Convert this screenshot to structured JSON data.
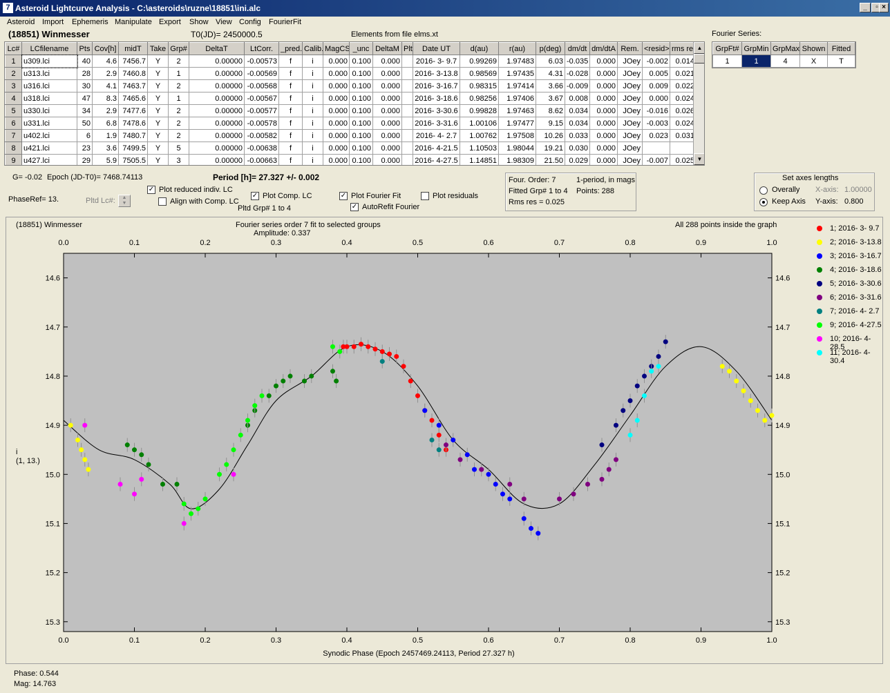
{
  "window": {
    "title": "Asteroid Lightcurve Analysis - C:\\asteroids\\ruzne\\18851\\ini.alc"
  },
  "menu": [
    "Asteroid",
    "Import",
    "Ephemeris",
    "Manipulate",
    "Export",
    "Show",
    "View",
    "Config",
    "FourierFit"
  ],
  "header": {
    "asteroid": "(18851) Winmesser",
    "t0": "T0(JD)= 2450000.5",
    "elements": "Elements from file elms.xt"
  },
  "lc_table": {
    "columns": [
      "Lc#",
      "LCfilename",
      "Pts",
      "Cov[h]",
      "midT",
      "Take",
      "Grp#",
      "DeltaT",
      "LtCorr.",
      "_pred.",
      "Calib.",
      "MagCS",
      "_unc",
      "DeltaM",
      "Plt",
      "Date UT",
      "d(au)",
      "r(au)",
      "p(deg)",
      "dm/dt",
      "dm/dtA",
      "Rem.",
      "<resid>",
      "rms res"
    ],
    "rows": [
      [
        "1",
        "u309.lci",
        "40",
        "4.6",
        "7456.7",
        "Y",
        "2",
        "0.00000",
        "-0.00573",
        "f",
        "i",
        "0.000",
        "0.100",
        "0.000",
        "",
        "2016- 3- 9.7",
        "0.99269",
        "1.97483",
        "6.03",
        "-0.035",
        "0.000",
        "JOey",
        "-0.002",
        "0.014"
      ],
      [
        "2",
        "u313.lci",
        "28",
        "2.9",
        "7460.8",
        "Y",
        "1",
        "0.00000",
        "-0.00569",
        "f",
        "i",
        "0.000",
        "0.100",
        "0.000",
        "",
        "2016- 3-13.8",
        "0.98569",
        "1.97435",
        "4.31",
        "-0.028",
        "0.000",
        "JOey",
        "0.005",
        "0.021"
      ],
      [
        "3",
        "u316.lci",
        "30",
        "4.1",
        "7463.7",
        "Y",
        "2",
        "0.00000",
        "-0.00568",
        "f",
        "i",
        "0.000",
        "0.100",
        "0.000",
        "",
        "2016- 3-16.7",
        "0.98315",
        "1.97414",
        "3.66",
        "-0.009",
        "0.000",
        "JOey",
        "0.009",
        "0.022"
      ],
      [
        "4",
        "u318.lci",
        "47",
        "8.3",
        "7465.6",
        "Y",
        "1",
        "0.00000",
        "-0.00567",
        "f",
        "i",
        "0.000",
        "0.100",
        "0.000",
        "",
        "2016- 3-18.6",
        "0.98256",
        "1.97406",
        "3.67",
        "0.008",
        "0.000",
        "JOey",
        "0.000",
        "0.024"
      ],
      [
        "5",
        "u330.lci",
        "34",
        "2.9",
        "7477.6",
        "Y",
        "2",
        "0.00000",
        "-0.00577",
        "f",
        "i",
        "0.000",
        "0.100",
        "0.000",
        "",
        "2016- 3-30.6",
        "0.99828",
        "1.97463",
        "8.62",
        "0.034",
        "0.000",
        "JOey",
        "-0.016",
        "0.026"
      ],
      [
        "6",
        "u331.lci",
        "50",
        "6.8",
        "7478.6",
        "Y",
        "2",
        "0.00000",
        "-0.00578",
        "f",
        "i",
        "0.000",
        "0.100",
        "0.000",
        "",
        "2016- 3-31.6",
        "1.00106",
        "1.97477",
        "9.15",
        "0.034",
        "0.000",
        "JOey",
        "-0.003",
        "0.024"
      ],
      [
        "7",
        "u402.lci",
        "6",
        "1.9",
        "7480.7",
        "Y",
        "2",
        "0.00000",
        "-0.00582",
        "f",
        "i",
        "0.000",
        "0.100",
        "0.000",
        "",
        "2016- 4- 2.7",
        "1.00762",
        "1.97508",
        "10.26",
        "0.033",
        "0.000",
        "JOey",
        "0.023",
        "0.031"
      ],
      [
        "8",
        "u421.lci",
        "23",
        "3.6",
        "7499.5",
        "Y",
        "5",
        "0.00000",
        "-0.00638",
        "f",
        "i",
        "0.000",
        "0.100",
        "0.000",
        "",
        "2016- 4-21.5",
        "1.10503",
        "1.98044",
        "19.21",
        "0.030",
        "0.000",
        "JOey",
        "",
        ""
      ],
      [
        "9",
        "u427.lci",
        "29",
        "5.9",
        "7505.5",
        "Y",
        "3",
        "0.00000",
        "-0.00663",
        "f",
        "i",
        "0.000",
        "0.100",
        "0.000",
        "",
        "2016- 4-27.5",
        "1.14851",
        "1.98309",
        "21.50",
        "0.029",
        "0.000",
        "JOey",
        "-0.007",
        "0.025"
      ]
    ]
  },
  "fourier_table": {
    "label": "Fourier Series:",
    "columns": [
      "GrpFt#",
      "GrpMin",
      "GrpMax",
      "Shown",
      "Fitted"
    ],
    "row": [
      "1",
      "1",
      "4",
      "X",
      "T"
    ]
  },
  "info": {
    "g": "G= -0.02",
    "epoch": "Epoch (JD-T0)= 7468.74113",
    "period": "Period [h]= 27.327 +/- 0.002",
    "phaseref": "PhaseRef= 13.",
    "pltd_lc": "Pltd Lc#:",
    "plot_reduced": "Plot reduced indiv. LC",
    "align_comp": "Align with Comp. LC",
    "plot_comp": "Plot Comp. LC",
    "pltd_grp": "Pltd Grp#  1   to   4",
    "plot_fourier": "Plot Fourier Fit",
    "autorefit": "AutoRefit Fourier",
    "plot_residuals": "Plot residuals",
    "four_order": "Four. Order:  7",
    "one_period": "1-period, in mags",
    "fitted_grp": "Fitted Grp# 1 to 4",
    "points": "Points: 288",
    "rms": "Rms res     = 0.025"
  },
  "axes_box": {
    "title": "Set axes lengths",
    "overally": "Overally",
    "keep_axis": "Keep Axis",
    "xaxis_label": "X-axis:",
    "xaxis_val": "1.00000",
    "yaxis_label": "Y-axis:",
    "yaxis_val": "0.800"
  },
  "plot": {
    "name": "(18851) Winmesser",
    "fit_title": "Fourier series order 7 fit to selected groups",
    "amplitude": "Amplitude: 0.337",
    "inside": "All 288 points inside the graph",
    "ylabel": "i",
    "ylabel2": "(1, 13.)",
    "xlabel": "Synodic Phase (Epoch 2457469.24113, Period 27.327 h)"
  },
  "status": {
    "phase": "Phase:  0.544",
    "mag": "Mag:    14.763"
  },
  "chart_data": {
    "type": "scatter",
    "xlim": [
      0,
      1
    ],
    "ylim": [
      14.55,
      15.32
    ],
    "y_inverted": true,
    "xticks": [
      0.0,
      0.1,
      0.2,
      0.3,
      0.4,
      0.5,
      0.6,
      0.7,
      0.8,
      0.9,
      1.0
    ],
    "yticks": [
      14.6,
      14.7,
      14.8,
      14.9,
      15.0,
      15.1,
      15.2,
      15.3
    ],
    "legend_position": "right",
    "series": [
      {
        "name": "1; 2016- 3- 9.7",
        "color": "#ff0000",
        "points": [
          [
            0.41,
            14.74
          ],
          [
            0.42,
            14.735
          ],
          [
            0.43,
            14.74
          ],
          [
            0.44,
            14.745
          ],
          [
            0.45,
            14.75
          ],
          [
            0.46,
            14.755
          ],
          [
            0.47,
            14.76
          ],
          [
            0.48,
            14.78
          ],
          [
            0.49,
            14.81
          ],
          [
            0.5,
            14.84
          ],
          [
            0.51,
            14.87
          ],
          [
            0.52,
            14.89
          ],
          [
            0.53,
            14.92
          ],
          [
            0.54,
            14.95
          ],
          [
            0.4,
            14.74
          ],
          [
            0.395,
            14.74
          ]
        ]
      },
      {
        "name": "2; 2016- 3-13.8",
        "color": "#ffff00",
        "points": [
          [
            0.01,
            14.9
          ],
          [
            0.02,
            14.93
          ],
          [
            0.025,
            14.95
          ],
          [
            0.03,
            14.97
          ],
          [
            0.035,
            14.99
          ],
          [
            0.93,
            14.78
          ],
          [
            0.94,
            14.79
          ],
          [
            0.95,
            14.81
          ],
          [
            0.96,
            14.83
          ],
          [
            0.97,
            14.85
          ],
          [
            0.98,
            14.87
          ],
          [
            0.99,
            14.89
          ],
          [
            1.0,
            14.88
          ]
        ]
      },
      {
        "name": "3; 2016- 3-16.7",
        "color": "#0000ff",
        "points": [
          [
            0.51,
            14.87
          ],
          [
            0.53,
            14.9
          ],
          [
            0.55,
            14.93
          ],
          [
            0.57,
            14.96
          ],
          [
            0.58,
            14.99
          ],
          [
            0.6,
            15.0
          ],
          [
            0.61,
            15.02
          ],
          [
            0.62,
            15.04
          ],
          [
            0.63,
            15.05
          ],
          [
            0.65,
            15.09
          ],
          [
            0.66,
            15.11
          ],
          [
            0.67,
            15.12
          ]
        ]
      },
      {
        "name": "4; 2016- 3-18.6",
        "color": "#008000",
        "points": [
          [
            0.09,
            14.94
          ],
          [
            0.1,
            14.95
          ],
          [
            0.11,
            14.96
          ],
          [
            0.12,
            14.98
          ],
          [
            0.14,
            15.02
          ],
          [
            0.16,
            15.02
          ],
          [
            0.26,
            14.9
          ],
          [
            0.27,
            14.87
          ],
          [
            0.29,
            14.84
          ],
          [
            0.3,
            14.82
          ],
          [
            0.31,
            14.81
          ],
          [
            0.32,
            14.8
          ],
          [
            0.34,
            14.81
          ],
          [
            0.35,
            14.8
          ],
          [
            0.38,
            14.79
          ],
          [
            0.385,
            14.81
          ]
        ]
      },
      {
        "name": "5; 2016- 3-30.6",
        "color": "#000080",
        "points": [
          [
            0.76,
            14.94
          ],
          [
            0.78,
            14.9
          ],
          [
            0.79,
            14.87
          ],
          [
            0.8,
            14.85
          ],
          [
            0.81,
            14.82
          ],
          [
            0.82,
            14.8
          ],
          [
            0.83,
            14.78
          ],
          [
            0.84,
            14.76
          ],
          [
            0.85,
            14.73
          ]
        ]
      },
      {
        "name": "6; 2016- 3-31.6",
        "color": "#800080",
        "points": [
          [
            0.54,
            14.94
          ],
          [
            0.56,
            14.97
          ],
          [
            0.59,
            14.99
          ],
          [
            0.63,
            15.02
          ],
          [
            0.65,
            15.05
          ],
          [
            0.7,
            15.05
          ],
          [
            0.72,
            15.04
          ],
          [
            0.74,
            15.02
          ],
          [
            0.76,
            15.01
          ],
          [
            0.77,
            14.99
          ],
          [
            0.78,
            14.97
          ]
        ]
      },
      {
        "name": "7; 2016- 4- 2.7",
        "color": "#008080",
        "points": [
          [
            0.45,
            14.77
          ],
          [
            0.52,
            14.93
          ],
          [
            0.53,
            14.95
          ]
        ]
      },
      {
        "name": "9; 2016- 4-27.5",
        "color": "#00ff00",
        "points": [
          [
            0.17,
            15.06
          ],
          [
            0.18,
            15.08
          ],
          [
            0.19,
            15.07
          ],
          [
            0.2,
            15.05
          ],
          [
            0.22,
            15.0
          ],
          [
            0.23,
            14.98
          ],
          [
            0.24,
            14.95
          ],
          [
            0.25,
            14.92
          ],
          [
            0.26,
            14.89
          ],
          [
            0.27,
            14.86
          ],
          [
            0.28,
            14.84
          ],
          [
            0.38,
            14.74
          ],
          [
            0.39,
            14.75
          ]
        ]
      },
      {
        "name": "10; 2016- 4-28.5",
        "color": "#ff00ff",
        "points": [
          [
            0.03,
            14.9
          ],
          [
            0.08,
            15.02
          ],
          [
            0.1,
            15.04
          ],
          [
            0.11,
            15.01
          ],
          [
            0.17,
            15.1
          ],
          [
            0.24,
            15.0
          ]
        ]
      },
      {
        "name": "11; 2016- 4-30.4",
        "color": "#00ffff",
        "points": [
          [
            0.8,
            14.92
          ],
          [
            0.81,
            14.89
          ],
          [
            0.82,
            14.84
          ],
          [
            0.83,
            14.79
          ],
          [
            0.84,
            14.78
          ]
        ]
      }
    ],
    "fit_curve": [
      [
        0,
        14.89
      ],
      [
        0.05,
        14.95
      ],
      [
        0.1,
        14.97
      ],
      [
        0.15,
        15.02
      ],
      [
        0.18,
        15.07
      ],
      [
        0.22,
        15.03
      ],
      [
        0.26,
        14.94
      ],
      [
        0.3,
        14.85
      ],
      [
        0.35,
        14.8
      ],
      [
        0.4,
        14.74
      ],
      [
        0.45,
        14.75
      ],
      [
        0.5,
        14.82
      ],
      [
        0.55,
        14.93
      ],
      [
        0.6,
        14.99
      ],
      [
        0.65,
        15.06
      ],
      [
        0.7,
        15.06
      ],
      [
        0.75,
        14.98
      ],
      [
        0.8,
        14.88
      ],
      [
        0.85,
        14.78
      ],
      [
        0.9,
        14.74
      ],
      [
        0.95,
        14.79
      ],
      [
        1.0,
        14.89
      ]
    ]
  }
}
